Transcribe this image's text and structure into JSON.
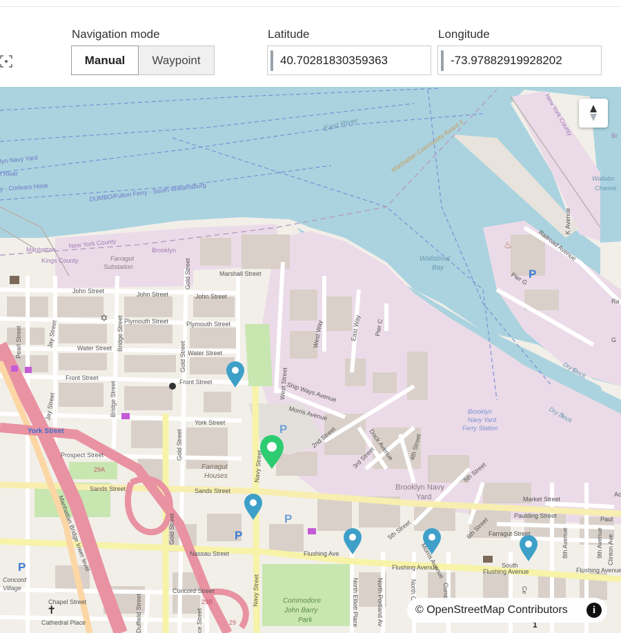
{
  "toolbar": {
    "navigation_mode_label": "Navigation mode",
    "mode_manual": "Manual",
    "mode_waypoint": "Waypoint",
    "selected_mode": "Manual",
    "latitude_label": "Latitude",
    "latitude_value": "40.70281830359363",
    "longitude_label": "Longitude",
    "longitude_value": "-73.97882919928202"
  },
  "map": {
    "attribution": "© OpenStreetMap Contributors",
    "info_glyph": "i",
    "labels": {
      "east_river": "East River",
      "manhattan_cb3": "Manhattan Community Board 3",
      "navy_yard": "lyn Navy Yard",
      "t_river": "t River",
      "corlears": "y - Corlears Hook",
      "dumbo": "DUMBO/Fulton Ferry - South Williamsburg",
      "manhattan": "Manhattan",
      "new_york_county": "New York County",
      "kings_county": "Kings County",
      "farragut_sub": "Farragut",
      "substation": "Substation",
      "brooklyn": "Brooklyn",
      "wallabout_bay": "Wallabout",
      "bay": "Bay",
      "railroad_ave": "Railroad Avenue",
      "pier_g": "Pier G",
      "marshall_st": "Marshall Street",
      "john_st_1": "John Street",
      "john_st_2": "John Street",
      "john_st_3": "John Street",
      "plymouth_st_1": "Plymouth Street",
      "plymouth_st_2": "Plymouth Street",
      "water_st_1": "Water Street",
      "water_st_2": "Water Street",
      "front_st_1": "Front Street",
      "front_st_2": "Front Street",
      "york_st_1": "York Street",
      "york_st_2": "York Street",
      "prospect_st": "Prospect Street",
      "sands_st_1": "Sands Street",
      "sands_st_2": "Sands Street",
      "nassau_st": "Nassau Street",
      "concord_st": "Concord Street",
      "chapel_st": "Chapel Street",
      "cathedral_pl": "Cathedral Place",
      "pearl_st": "Pearl Street",
      "jay_st_1": "Jay Street",
      "jay_st_2": "Jay Street",
      "bridge_st_1": "Bridge Street",
      "bridge_st_2": "Bridge Street",
      "gold_st_1": "Gold Street",
      "gold_st_2": "Gold Street",
      "gold_st_3": "Gold Street",
      "gold_st_4": "Gold Street",
      "john_st_v": "John Street",
      "navy_st_1": "Navy Street",
      "navy_st_2": "Navy Street",
      "west_st": "West Street",
      "west_way": "West Way",
      "east_way": "East Way",
      "pier_c": "Pier C",
      "ship_ways": "Ship Ways Avenue",
      "morris_ave_1": "Morris Avenue",
      "morris_ave_2": "Morris Avenue",
      "second_st": "2nd Street",
      "third_st": "3rd Street",
      "dock_ave": "Dock Avenue",
      "fourth_st": "4th Street",
      "fifth_st_1": "5th Street",
      "fifth_st_2": "5th Street",
      "sixth_st": "6th Street",
      "flushing_ave_1": "Flushing Avenue",
      "flushing_ave_2": "Flushing Avenue",
      "flushing_ave_3": "Flushing Avenue",
      "flushing_ave_4": "Flushing Ave",
      "market_st": "Market Street",
      "paulding_st": "Paulding Street",
      "farragut_st": "Farragut Street",
      "paul": "Paul",
      "eighth_ave": "8th Avenue",
      "ninth_ave": "9th Avenue",
      "clinton_ave": "Clinton Ave",
      "north_elliott": "North Elliott Place",
      "north_portland": "North Portland Av",
      "brooklyn_navy_yard": "Brooklyn Navy",
      "yard": "Yard",
      "ferry_1": "Brooklyn",
      "ferry_2": "Navy Yard",
      "ferry_3": "Ferry Station",
      "farragut_houses_1": "Farragut",
      "farragut_houses_2": "Houses",
      "commodore_1": "Commodore",
      "commodore_2": "John Barry",
      "commodore_3": "Park",
      "manhattan_bridge": "Manhattan Bridge lower level",
      "dry_dock_6": "Dry Dock",
      "dry_dock_5": "Dry Dock",
      "n6": "6",
      "n5": "5",
      "concord": "Concord",
      "village": "Village",
      "new_york_county_2": "New York County",
      "k_avenue": "K Avenue",
      "wallabout_ch": "Wallabo",
      "channel": "Channe",
      "b29a": "29A",
      "b29b": "29B",
      "b29": "29",
      "br": "Br",
      "n_1": "1",
      "g": "G",
      "ra": "Ra",
      "north_c": "North C",
      "cumb": "Cumb",
      "ce": "Ce",
      "ce2": "ce Street",
      "duffield": "Duffield Street",
      "south": "South",
      "ac": "Ac",
      "yo": "York Street"
    },
    "pins": [
      {
        "name": "blue",
        "color": "#3ea0c9"
      },
      {
        "name": "green",
        "color": "#2ecc71"
      }
    ],
    "colors": {
      "water": "#aad3df",
      "land": "#f2efe9",
      "industrial": "#ebdbe8",
      "building": "#d9d0c9",
      "park": "#c8e6b0",
      "road_major": "#fcd6a4",
      "road_trunk": "#e892a2",
      "road_yellow": "#f7f3a8"
    }
  }
}
